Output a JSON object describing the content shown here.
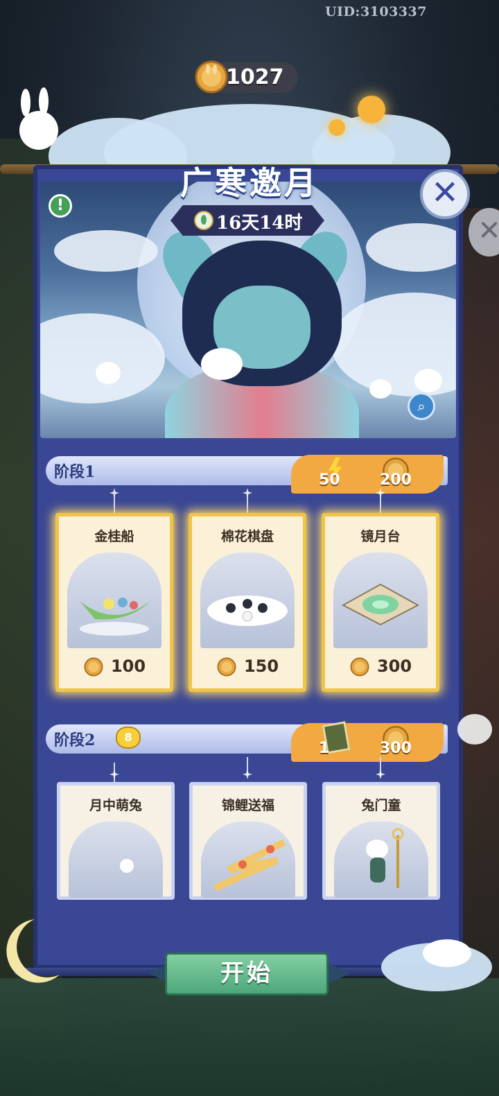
{
  "uid": "UID:3103337",
  "currency": {
    "amount": "1027",
    "icon": "mooncake-coin-icon"
  },
  "event": {
    "title": "广寒邀月",
    "timer": "16天14时"
  },
  "stages": [
    {
      "label": "阶段1",
      "rewards": [
        {
          "icon": "lightning-icon",
          "value": "50"
        },
        {
          "icon": "mooncake-coin-icon",
          "value": "200"
        }
      ],
      "items": [
        {
          "name": "金桂船",
          "price": "100"
        },
        {
          "name": "棉花棋盘",
          "price": "150"
        },
        {
          "name": "镜月台",
          "price": "300"
        }
      ]
    },
    {
      "label": "阶段2",
      "rewards": [
        {
          "icon": "ticket-icon",
          "value": "1"
        },
        {
          "icon": "mooncake-coin-icon",
          "value": "300"
        }
      ],
      "items": [
        {
          "name": "月中萌兔"
        },
        {
          "name": "锦鲤送福"
        },
        {
          "name": "兔门童"
        }
      ]
    }
  ],
  "buttons": {
    "start": "开始",
    "info": "!",
    "close": "✕",
    "zoom": "⌕"
  },
  "colors": {
    "panel": "#3a4794",
    "accent_gold": "#f0c448",
    "reward_orange": "#f2a941",
    "start_green": "#4ea77b"
  }
}
